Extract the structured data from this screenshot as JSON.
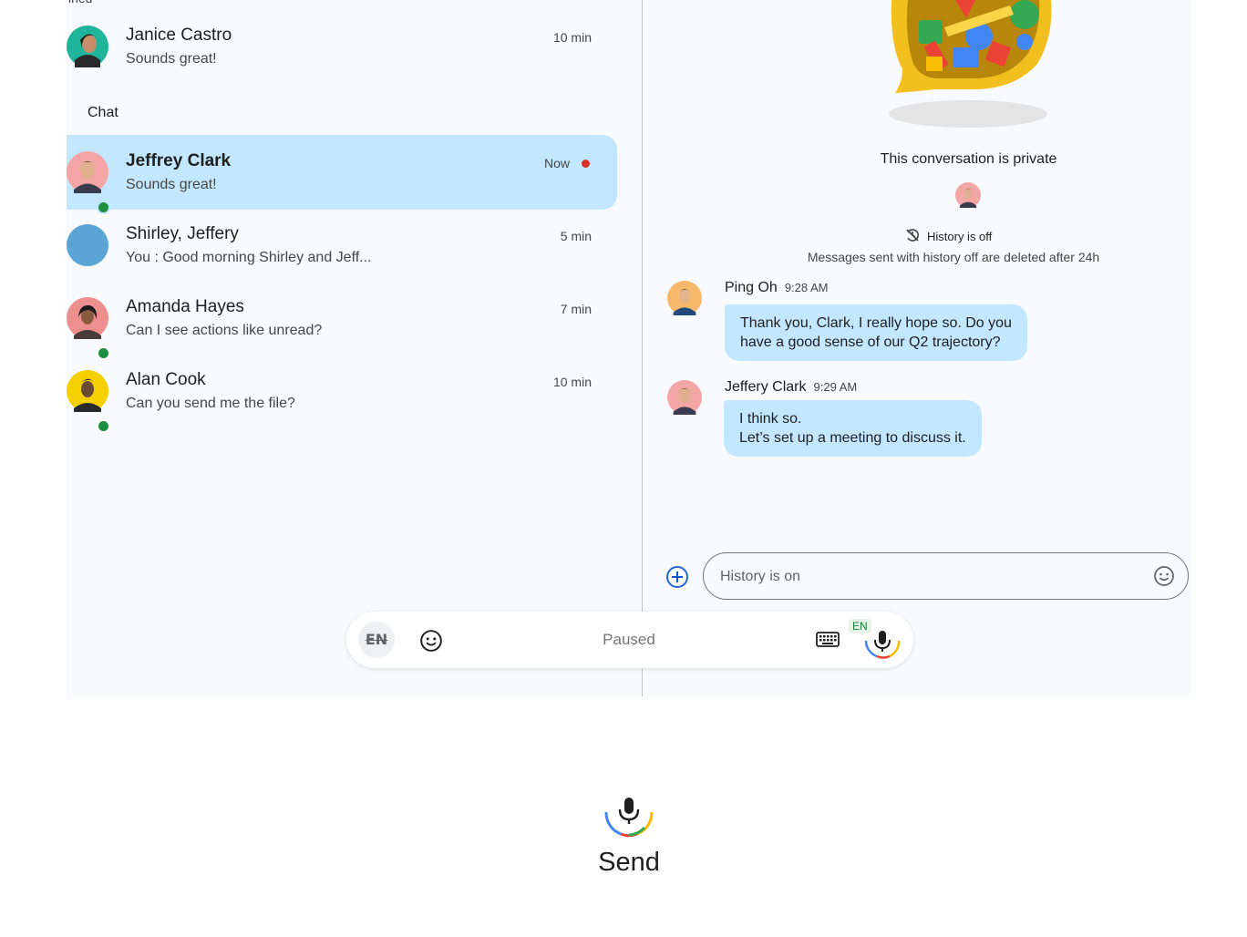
{
  "list": {
    "truncated_header": "ined",
    "section_label": "Chat",
    "pinned": [
      {
        "name": "Janice Castro",
        "preview": "Sounds great!",
        "time": "10 min"
      }
    ],
    "chats": [
      {
        "name": "Jeffrey Clark",
        "preview": "Sounds great!",
        "time": "Now",
        "selected": true,
        "unread": true,
        "online": true
      },
      {
        "name": "Shirley, Jeffery",
        "preview": "You : Good morning Shirley and Jeff...",
        "time": "5 min"
      },
      {
        "name": "Amanda Hayes",
        "preview": "Can I see actions like unread?",
        "time": "7 min",
        "online": true
      },
      {
        "name": "Alan Cook",
        "preview": "Can you send me the file?",
        "time": "10 min",
        "online": true
      }
    ]
  },
  "conversation": {
    "private_title": "This conversation is private",
    "history_status": "History is off",
    "history_note": "Messages sent with history off are deleted after 24h",
    "messages": [
      {
        "sender": "Ping Oh",
        "time": "9:28 AM",
        "lines": [
          "Thank you, Clark, I really hope so. Do you",
          "have a good sense of our Q2 trajectory?"
        ]
      },
      {
        "sender": "Jeffery Clark",
        "time": "9:29 AM",
        "lines": [
          "I think so.",
          "Let’s set up a meeting to discuss it."
        ]
      }
    ],
    "composer": {
      "placeholder": "History is on"
    }
  },
  "voice_toolbar": {
    "lang_button": "EN",
    "status": "Paused",
    "mic_lang_badge": "EN"
  },
  "voice_action": {
    "label": "Send"
  },
  "icons": {
    "composer_add": "add-circle-icon",
    "composer_emoji": "emoji-icon",
    "history_off": "history-off-icon",
    "toolbar_emoji": "emoji-icon",
    "keyboard": "keyboard-icon",
    "mic": "mic-icon"
  },
  "colors": {
    "selected_row": "#c2e7ff",
    "bubble": "#c2e7ff",
    "online": "#1e8e3e",
    "unread": "#d93025",
    "pane_bg": "#f8fafd"
  }
}
